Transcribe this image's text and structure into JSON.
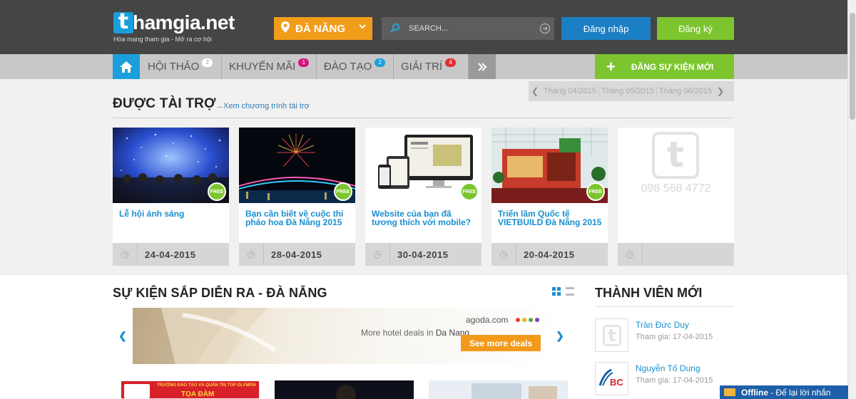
{
  "header": {
    "logo_text": "hamgia.net",
    "logo_tagline": "Hòa mạng tham gia - Mở ra cơ hội",
    "city": "ĐÀ NẴNG",
    "search_placeholder": "SEARCH...",
    "login_label": "Đăng nhập",
    "register_label": "Đăng ký"
  },
  "nav": {
    "items": [
      {
        "label": "HỘI THẢO",
        "badge": "2",
        "badge_color": "#ffffff"
      },
      {
        "label": "KHUYẾN MÃI",
        "badge": "1",
        "badge_color": "#d5157a"
      },
      {
        "label": "ĐÀO TẠO",
        "badge": "2",
        "badge_color": "#1a9fdc"
      },
      {
        "label": "GIẢI TRÍ",
        "badge": "4",
        "badge_color": "#e03030"
      }
    ],
    "post_event_label": "ĐĂNG SỰ KIỆN MỚI"
  },
  "sponsored": {
    "title": "ĐƯỢC TÀI TRỢ",
    "view_link": "Xem chương trình tài trợ",
    "months": [
      "Tháng 04/2015",
      "Tháng 05/2015",
      "Tháng 06/2015"
    ],
    "free_label": "FREE",
    "cards": [
      {
        "title": "Lễ hội ánh sáng",
        "date": "24-04-2015"
      },
      {
        "title": "Bạn cần biết về cuộc thi pháo hoa Đà Nẵng 2015",
        "date": "28-04-2015"
      },
      {
        "title": "Website của bạn đã tương thích với mobile?",
        "date": "30-04-2015"
      },
      {
        "title": "Triển lãm Quốc tế VIETBUILD Đà Nẵng 2015",
        "date": "20-04-2015"
      }
    ],
    "placeholder_phone": "098 568 4772"
  },
  "upcoming": {
    "title": "SỰ KIỆN SẮP DIỄN RA - ĐÀ NẴNG",
    "banner": {
      "brand": "agoda.com",
      "text_prefix": "More hotel deals in",
      "text_city": "Da Nang",
      "button": "See more deals"
    },
    "thumb1_line1": "TRƯỜNG ĐÀO TẠO VÀ QUẢN TRỊ TOP OLYMPIA",
    "thumb1_line2": "TỌA ĐÀM"
  },
  "members": {
    "title": "THÀNH VIÊN MỚI",
    "list": [
      {
        "name": "Trần Đức Duy",
        "joined": "Tham gia: 17-04-2015"
      },
      {
        "name": "Nguyễn Tố Dung",
        "joined": "Tham gia: 17-04-2015"
      }
    ]
  },
  "chat": {
    "status": "Offline",
    "text": "- Để lại lời nhắn"
  },
  "colors": {
    "brand_blue": "#1a9fdc",
    "green": "#7cc52e",
    "orange": "#f29d1a",
    "dark_header": "#454545"
  }
}
